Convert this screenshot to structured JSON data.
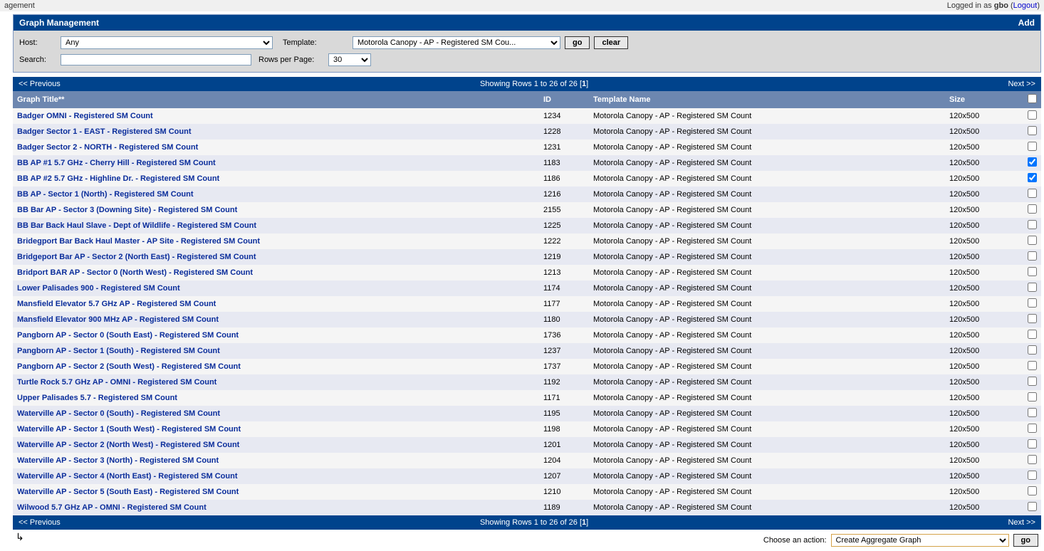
{
  "topbar": {
    "left": "agement",
    "logged_in_prefix": "Logged in as ",
    "user": "gbo",
    "logout": "Logout"
  },
  "panel": {
    "title": "Graph Management",
    "add": "Add"
  },
  "filters": {
    "host_label": "Host:",
    "host_value": "Any",
    "template_label": "Template:",
    "template_value": "Motorola Canopy - AP - Registered SM Cou...",
    "go": "go",
    "clear": "clear",
    "search_label": "Search:",
    "search_value": "",
    "rows_label": "Rows per Page:",
    "rows_value": "30"
  },
  "pager": {
    "prev": "<< Previous",
    "showing": "Showing Rows 1 to 26 of 26 [",
    "page": "1",
    "closing": "]",
    "next": "Next >>"
  },
  "columns": {
    "title": "Graph Title**",
    "id": "ID",
    "template": "Template Name",
    "size": "Size"
  },
  "rows": [
    {
      "title": "Badger OMNI - Registered SM Count",
      "id": "1234",
      "template": "Motorola Canopy - AP - Registered SM Count",
      "size": "120x500",
      "checked": false
    },
    {
      "title": "Badger Sector 1 - EAST - Registered SM Count",
      "id": "1228",
      "template": "Motorola Canopy - AP - Registered SM Count",
      "size": "120x500",
      "checked": false
    },
    {
      "title": "Badger Sector 2 - NORTH - Registered SM Count",
      "id": "1231",
      "template": "Motorola Canopy - AP - Registered SM Count",
      "size": "120x500",
      "checked": false
    },
    {
      "title": "BB AP #1 5.7 GHz - Cherry Hill - Registered SM Count",
      "id": "1183",
      "template": "Motorola Canopy - AP - Registered SM Count",
      "size": "120x500",
      "checked": true
    },
    {
      "title": "BB AP #2 5.7 GHz - Highline Dr. - Registered SM Count",
      "id": "1186",
      "template": "Motorola Canopy - AP - Registered SM Count",
      "size": "120x500",
      "checked": true
    },
    {
      "title": "BB AP - Sector 1 (North) - Registered SM Count",
      "id": "1216",
      "template": "Motorola Canopy - AP - Registered SM Count",
      "size": "120x500",
      "checked": false
    },
    {
      "title": "BB Bar AP - Sector 3 (Downing Site) - Registered SM Count",
      "id": "2155",
      "template": "Motorola Canopy - AP - Registered SM Count",
      "size": "120x500",
      "checked": false
    },
    {
      "title": "BB Bar Back Haul Slave - Dept of Wildlife - Registered SM Count",
      "id": "1225",
      "template": "Motorola Canopy - AP - Registered SM Count",
      "size": "120x500",
      "checked": false
    },
    {
      "title": "Bridegport Bar Back Haul Master - AP Site - Registered SM Count",
      "id": "1222",
      "template": "Motorola Canopy - AP - Registered SM Count",
      "size": "120x500",
      "checked": false
    },
    {
      "title": "Bridgeport Bar AP - Sector 2 (North East) - Registered SM Count",
      "id": "1219",
      "template": "Motorola Canopy - AP - Registered SM Count",
      "size": "120x500",
      "checked": false
    },
    {
      "title": "Bridport BAR AP - Sector 0 (North West) - Registered SM Count",
      "id": "1213",
      "template": "Motorola Canopy - AP - Registered SM Count",
      "size": "120x500",
      "checked": false
    },
    {
      "title": "Lower Palisades 900 - Registered SM Count",
      "id": "1174",
      "template": "Motorola Canopy - AP - Registered SM Count",
      "size": "120x500",
      "checked": false
    },
    {
      "title": "Mansfield Elevator 5.7 GHz AP - Registered SM Count",
      "id": "1177",
      "template": "Motorola Canopy - AP - Registered SM Count",
      "size": "120x500",
      "checked": false
    },
    {
      "title": "Mansfield Elevator 900 MHz AP - Registered SM Count",
      "id": "1180",
      "template": "Motorola Canopy - AP - Registered SM Count",
      "size": "120x500",
      "checked": false
    },
    {
      "title": "Pangborn AP - Sector 0 (South East) - Registered SM Count",
      "id": "1736",
      "template": "Motorola Canopy - AP - Registered SM Count",
      "size": "120x500",
      "checked": false
    },
    {
      "title": "Pangborn AP - Sector 1 (South) - Registered SM Count",
      "id": "1237",
      "template": "Motorola Canopy - AP - Registered SM Count",
      "size": "120x500",
      "checked": false
    },
    {
      "title": "Pangborn AP - Sector 2 (South West) - Registered SM Count",
      "id": "1737",
      "template": "Motorola Canopy - AP - Registered SM Count",
      "size": "120x500",
      "checked": false
    },
    {
      "title": "Turtle Rock 5.7 GHz AP - OMNI - Registered SM Count",
      "id": "1192",
      "template": "Motorola Canopy - AP - Registered SM Count",
      "size": "120x500",
      "checked": false
    },
    {
      "title": "Upper Palisades 5.7 - Registered SM Count",
      "id": "1171",
      "template": "Motorola Canopy - AP - Registered SM Count",
      "size": "120x500",
      "checked": false
    },
    {
      "title": "Waterville AP - Sector 0 (South) - Registered SM Count",
      "id": "1195",
      "template": "Motorola Canopy - AP - Registered SM Count",
      "size": "120x500",
      "checked": false
    },
    {
      "title": "Waterville AP - Sector 1 (South West) - Registered SM Count",
      "id": "1198",
      "template": "Motorola Canopy - AP - Registered SM Count",
      "size": "120x500",
      "checked": false
    },
    {
      "title": "Waterville AP - Sector 2 (North West) - Registered SM Count",
      "id": "1201",
      "template": "Motorola Canopy - AP - Registered SM Count",
      "size": "120x500",
      "checked": false
    },
    {
      "title": "Waterville AP - Sector 3 (North) - Registered SM Count",
      "id": "1204",
      "template": "Motorola Canopy - AP - Registered SM Count",
      "size": "120x500",
      "checked": false
    },
    {
      "title": "Waterville AP - Sector 4 (North East) - Registered SM Count",
      "id": "1207",
      "template": "Motorola Canopy - AP - Registered SM Count",
      "size": "120x500",
      "checked": false
    },
    {
      "title": "Waterville AP - Sector 5 (South East) - Registered SM Count",
      "id": "1210",
      "template": "Motorola Canopy - AP - Registered SM Count",
      "size": "120x500",
      "checked": false
    },
    {
      "title": "Wilwood 5.7 GHz AP - OMNI - Registered SM Count",
      "id": "1189",
      "template": "Motorola Canopy - AP - Registered SM Count",
      "size": "120x500",
      "checked": false
    }
  ],
  "footer": {
    "action_label": "Choose an action:",
    "action_value": "Create Aggregate Graph",
    "go": "go"
  }
}
